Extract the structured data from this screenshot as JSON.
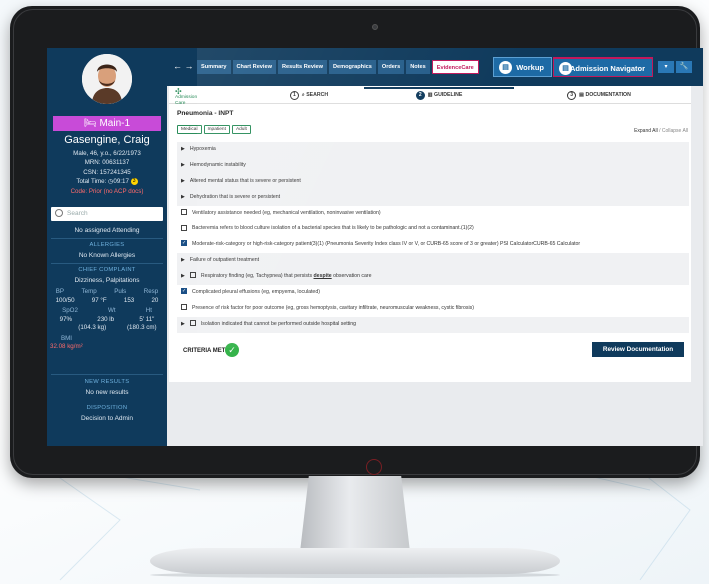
{
  "patient": {
    "location": "Main-1",
    "name": "Gasengine, Craig",
    "demographics": "Male, 46, y.o., 6/22/1973",
    "mrn": "MRN: 00631137",
    "csn": "CSN: 157241345",
    "total_time_label": "Total Time:",
    "total_time": "09:17",
    "total_time_badge": "3",
    "code": "Code: Prior (no ACP docs)",
    "search_placeholder": "Search",
    "attending": "No assigned Attending",
    "allergies_heading": "ALLERGIES",
    "allergies": "No Known Allergies",
    "complaint_heading": "CHIEF COMPLAINT",
    "complaint": "Dizziness, Palpitations",
    "vitals": {
      "bp_label": "BP",
      "temp_label": "Temp",
      "puls_label": "Puls",
      "resp_label": "Resp",
      "bp": "100/50",
      "temp": "97 °F",
      "puls": "153",
      "resp": "20",
      "spo2_label": "SpO2",
      "wt_label": "Wt",
      "ht_label": "Ht",
      "spo2": "97%",
      "wt": "230 lb",
      "ht": "5' 11\"",
      "wt_kg": "(104.3 kg)",
      "ht_cm": "(180.3 cm)",
      "bmi_label": "BMI",
      "bmi": "32.08 kg/m²"
    },
    "new_results_heading": "NEW RESULTS",
    "new_results": "No new results",
    "disposition_heading": "DISPOSITION",
    "disposition": "Decision to Admin"
  },
  "nav": {
    "arrows": "← →",
    "tabs": [
      "Summary",
      "Chart Review",
      "Results Review",
      "Demographics",
      "Orders",
      "Notes",
      "EvidenceCare"
    ],
    "active_tab": "EvidenceCare",
    "workup_label": "Workup",
    "admission_label": "Admission Navigator",
    "dropdown_icon": "chevron-down-icon",
    "wrench_icon": "wrench-icon"
  },
  "guideline": {
    "logo_text": "Admission Care",
    "steps": [
      {
        "num": "1",
        "label": "SEARCH",
        "icon": "search-icon"
      },
      {
        "num": "2",
        "label": "GUIDELINE",
        "icon": "guideline-icon"
      },
      {
        "num": "3",
        "label": "DOCUMENTATION",
        "icon": "document-icon"
      }
    ],
    "title": "Pneumonia - INPT",
    "chips": [
      "Medical",
      "Inpatient",
      "Adult"
    ],
    "expand_all": "Expand All",
    "collapse_all": "/ Collapse All",
    "rows": [
      {
        "kind": "caret",
        "text": "Hypoxemia",
        "grey": true
      },
      {
        "kind": "caret",
        "text": "Hemodynamic instability",
        "grey": true
      },
      {
        "kind": "caret",
        "text": "Altered mental status that is severe or persistent",
        "grey": true
      },
      {
        "kind": "caret",
        "text": "Dehydration that is severe or persistent",
        "grey": true
      },
      {
        "kind": "checkbox",
        "checked": false,
        "text": "Ventilatory assistance needed (eg, mechanical ventilation, noninvasive ventilation)",
        "grey": false
      },
      {
        "kind": "checkbox",
        "checked": false,
        "text": "Bacteremia refers to blood culture isolation of a bacterial species that is likely to be pathologic and not a contaminant.(1)(2)",
        "grey": false
      },
      {
        "kind": "checkbox",
        "checked": true,
        "text": "Moderate-risk-category or high-risk-category patient(3)(1) (Pneumonia Severity Index class IV or V, or CURB-65 score of 3 or greater) PSI CalculatorCURB-65 Calculator",
        "grey": false
      },
      {
        "kind": "caret",
        "text": "Failure of outpatient treatment",
        "grey": true
      },
      {
        "kind": "caret-checkbox",
        "checked": false,
        "text_pre": "Respiratory finding (eg, Tachypnea) that persists ",
        "text_em": "despite",
        "text_post": " observation care",
        "grey": true
      },
      {
        "kind": "checkbox",
        "checked": true,
        "text": "Complicated pleural effusions (eg, empyema, loculated)",
        "grey": false
      },
      {
        "kind": "checkbox",
        "checked": false,
        "text": "Presence of risk factor for poor outcome (eg, gross hemoptysis, cavitary infiltrate, neuromuscular weakness, cystic fibrosis)",
        "grey": false
      },
      {
        "kind": "caret-checkbox",
        "checked": false,
        "text_pre": "Isolation indicated that cannot be performed outside hospital setting",
        "text_em": "",
        "text_post": "",
        "grey": true
      }
    ],
    "criteria_label": "CRITERIA MET",
    "review_button": "Review Documentation"
  },
  "colors": {
    "navy": "#0f3a5c",
    "accent_pink": "#c2185b",
    "location_purple": "#c84bd8",
    "success_green": "#35b34a"
  }
}
